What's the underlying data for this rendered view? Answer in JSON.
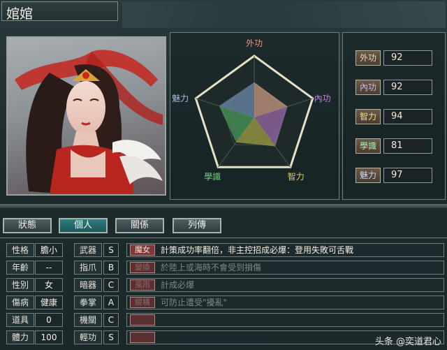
{
  "character": {
    "name": "婠婠"
  },
  "radar": {
    "axes": [
      "外功",
      "內功",
      "智力",
      "學識",
      "魅力"
    ],
    "values": [
      92,
      92,
      94,
      81,
      97
    ],
    "max": 100
  },
  "stats": [
    {
      "label": "外功",
      "value": "92",
      "color": "#f0d8a0"
    },
    {
      "label": "內功",
      "value": "92",
      "color": "#d8b8f0"
    },
    {
      "label": "智力",
      "value": "94",
      "color": "#f0e080"
    },
    {
      "label": "學識",
      "value": "81",
      "color": "#a8f0b0"
    },
    {
      "label": "魅力",
      "value": "97",
      "color": "#c8d8f0"
    }
  ],
  "tabs": [
    {
      "label": "狀態",
      "active": false
    },
    {
      "label": "個人",
      "active": true
    },
    {
      "label": "關係",
      "active": false
    },
    {
      "label": "列傳",
      "active": false
    }
  ],
  "info": [
    {
      "label": "性格",
      "value": "膽小"
    },
    {
      "label": "年齡",
      "value": "--"
    },
    {
      "label": "性別",
      "value": "女"
    },
    {
      "label": "傷病",
      "value": "健康"
    },
    {
      "label": "道具",
      "value": "0"
    },
    {
      "label": "體力",
      "value": "100"
    }
  ],
  "weapons": [
    {
      "label": "武器",
      "grade": "S"
    },
    {
      "label": "指爪",
      "grade": "B"
    },
    {
      "label": "暗器",
      "grade": "C"
    },
    {
      "label": "拳掌",
      "grade": "A"
    },
    {
      "label": "機關",
      "grade": "C"
    },
    {
      "label": "輕功",
      "grade": "S"
    }
  ],
  "skills": [
    {
      "tag": "魔女",
      "text": "計策成功率翻倍，非主控招成必爆：登用失敗可舌戰",
      "dim": false
    },
    {
      "tag": "變換",
      "text": "於陸上或海時不會受到損傷",
      "dim": true
    },
    {
      "tag": "風雨",
      "text": "計成必爆",
      "dim": true
    },
    {
      "tag": "縱橫",
      "text": "可防止遭受\"擾亂\"",
      "dim": true
    },
    {
      "tag": "",
      "text": "",
      "dim": true
    },
    {
      "tag": "",
      "text": "",
      "dim": true
    }
  ],
  "watermark": "头条 @奕道君心"
}
